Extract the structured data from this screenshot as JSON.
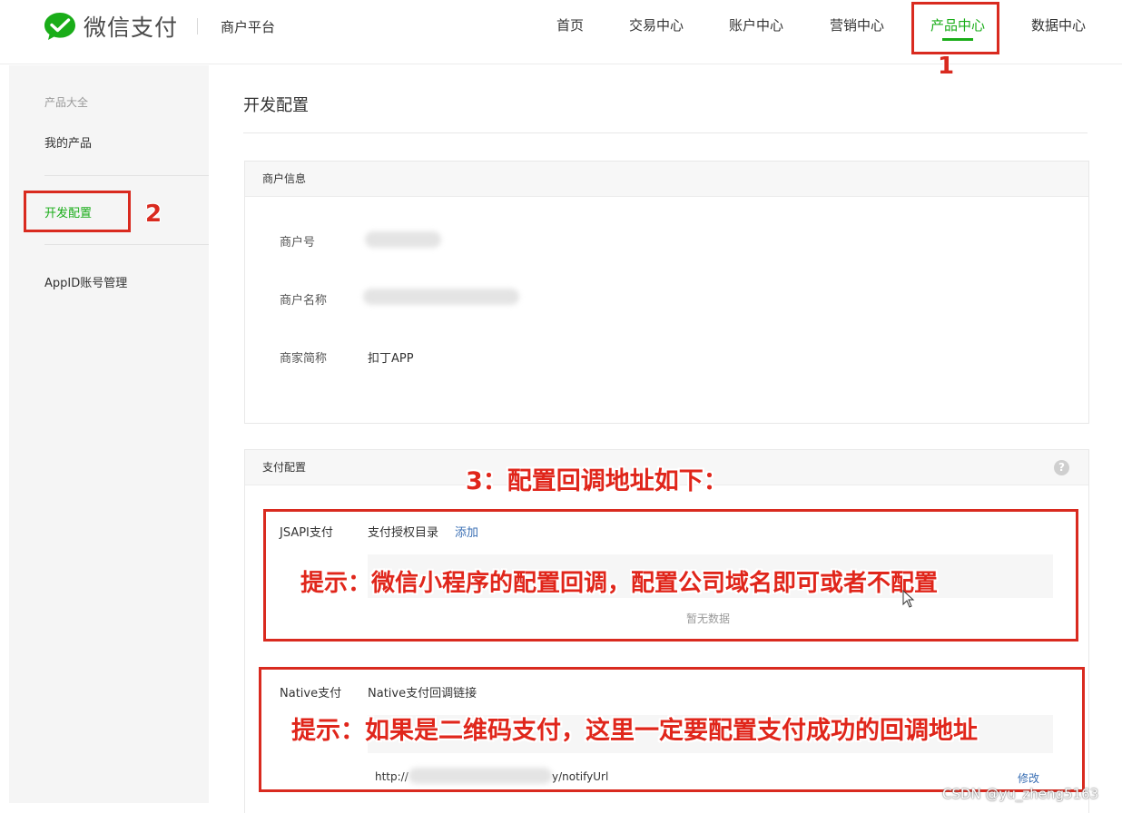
{
  "brand": {
    "logo_text": "微信支付",
    "platform": "商户平台",
    "accent_color": "#1aad19",
    "annotation_color": "#d92a1f"
  },
  "nav": {
    "items": [
      {
        "label": "首页"
      },
      {
        "label": "交易中心"
      },
      {
        "label": "账户中心"
      },
      {
        "label": "营销中心"
      },
      {
        "label": "产品中心",
        "active": true
      },
      {
        "label": "数据中心"
      }
    ]
  },
  "sidebar": {
    "header": "产品大全",
    "items": [
      {
        "label": "我的产品"
      },
      {
        "label": "开发配置",
        "active": true
      },
      {
        "label": "AppID账号管理"
      }
    ]
  },
  "main": {
    "title": "开发配置",
    "merchant_panel": {
      "title": "商户信息",
      "rows": [
        {
          "label": "商户号",
          "value": ""
        },
        {
          "label": "商户名称",
          "value": ""
        },
        {
          "label": "商家简称",
          "value": "扣丁APP"
        }
      ]
    },
    "payment_panel": {
      "title": "支付配置",
      "jsapi": {
        "label": "JSAPI支付",
        "field": "支付授权目录",
        "action": "添加",
        "empty": "暂无数据"
      },
      "native": {
        "label": "Native支付",
        "field": "Native支付回调链接",
        "url_prefix": "http://",
        "url_suffix": "y/notifyUrl",
        "action": "修改"
      }
    }
  },
  "annotations": {
    "step1": "1",
    "step2": "2",
    "step3": "3：配置回调地址如下：",
    "tip_jsapi": "提示：微信小程序的配置回调，配置公司域名即可或者不配置",
    "tip_native": "提示：如果是二维码支付，这里一定要配置支付成功的回调地址"
  },
  "watermark": "CSDN @yu_zheng5163"
}
